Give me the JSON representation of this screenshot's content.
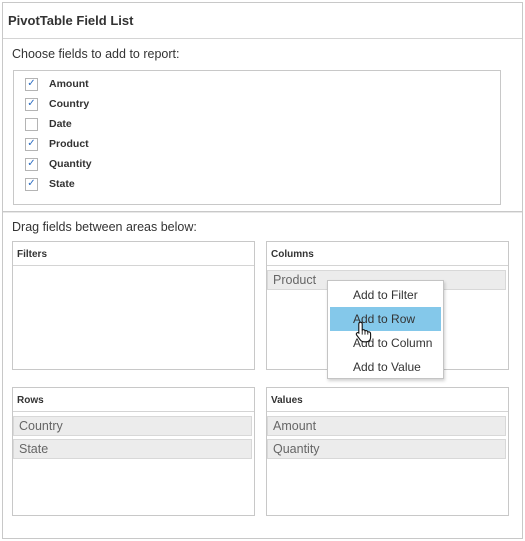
{
  "panel": {
    "title": "PivotTable Field List"
  },
  "fields_section": {
    "label": "Choose fields to add to report:",
    "items": [
      {
        "label": "Amount",
        "checked": true
      },
      {
        "label": "Country",
        "checked": true
      },
      {
        "label": "Date",
        "checked": false
      },
      {
        "label": "Product",
        "checked": true
      },
      {
        "label": "Quantity",
        "checked": true
      },
      {
        "label": "State",
        "checked": true
      }
    ]
  },
  "areas_section": {
    "label": "Drag fields between areas below:",
    "filters": {
      "title": "Filters",
      "items": []
    },
    "columns": {
      "title": "Columns",
      "items": [
        "Product"
      ]
    },
    "rows": {
      "title": "Rows",
      "items": [
        "Country",
        "State"
      ]
    },
    "values": {
      "title": "Values",
      "items": [
        "Amount",
        "Quantity"
      ]
    }
  },
  "context_menu": {
    "items": [
      "Add to Filter",
      "Add to Row",
      "Add to Column",
      "Add to Value"
    ],
    "active": "Add to Row"
  },
  "colors": {
    "check": "#2b6cc0",
    "menu_highlight": "#84c8ea",
    "item_bg": "#ececec"
  },
  "icons": {
    "check": "✓",
    "cursor": "hand-pointer-icon"
  }
}
